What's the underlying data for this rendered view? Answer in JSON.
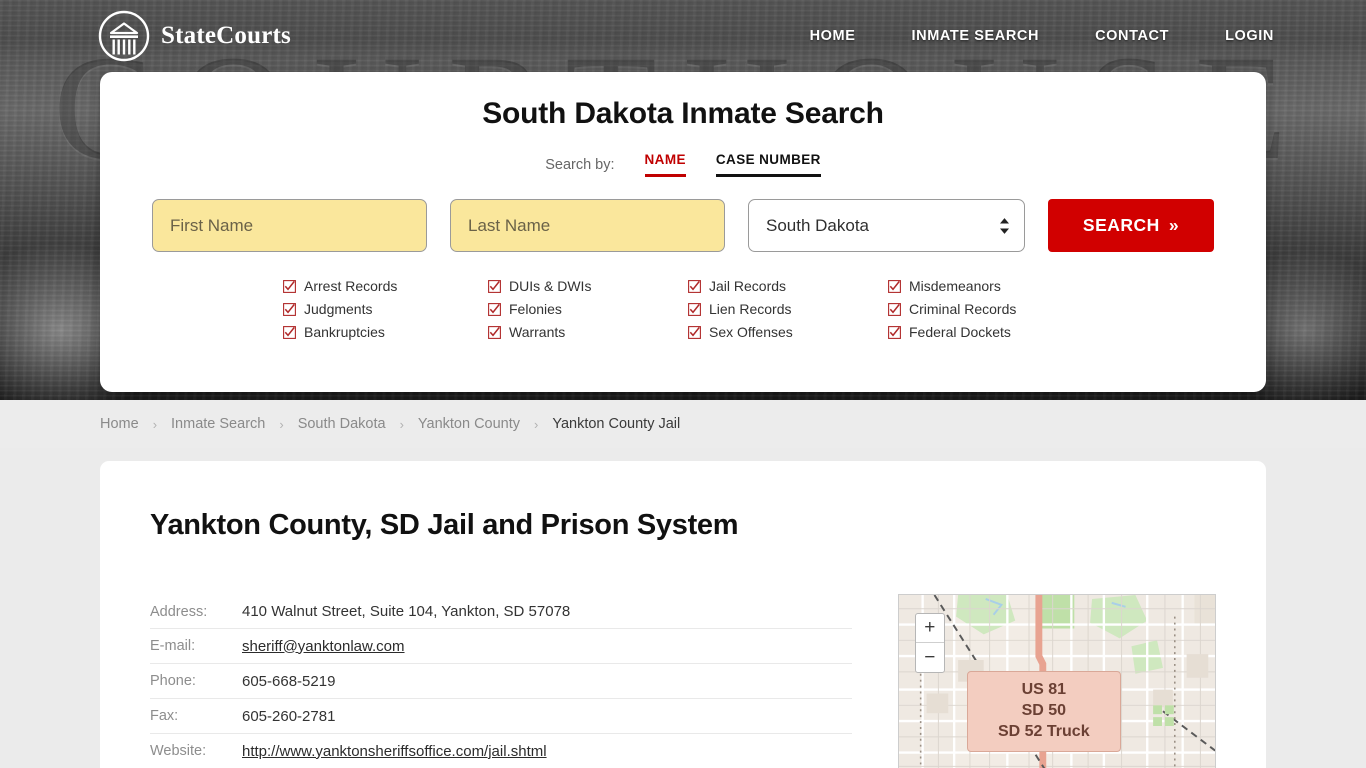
{
  "header": {
    "brand_name": "StateCourts",
    "logo_icon": "courthouse-circle-icon",
    "nav": [
      {
        "label": "HOME"
      },
      {
        "label": "INMATE SEARCH"
      },
      {
        "label": "CONTACT"
      },
      {
        "label": "LOGIN"
      }
    ],
    "background_ghost_text": "COURTHOUSE"
  },
  "search_card": {
    "title": "South Dakota Inmate Search",
    "search_by_label": "Search by:",
    "tabs": [
      {
        "label": "NAME",
        "active": true
      },
      {
        "label": "CASE NUMBER",
        "active": false
      }
    ],
    "first_name_placeholder": "First Name",
    "first_name_value": "",
    "last_name_placeholder": "Last Name",
    "last_name_value": "",
    "state_selected": "South Dakota",
    "search_button_label": "SEARCH",
    "search_button_chevron": "»",
    "checkbox_glyph": "☑",
    "accent_red": "#c00000",
    "button_red": "#d10000",
    "field_yellow": "#fae79c",
    "checks": [
      {
        "label": "Arrest Records",
        "checked": true
      },
      {
        "label": "DUIs & DWIs",
        "checked": true
      },
      {
        "label": "Jail Records",
        "checked": true
      },
      {
        "label": "Misdemeanors",
        "checked": true
      },
      {
        "label": "Judgments",
        "checked": true
      },
      {
        "label": "Felonies",
        "checked": true
      },
      {
        "label": "Lien Records",
        "checked": true
      },
      {
        "label": "Criminal Records",
        "checked": true
      },
      {
        "label": "Bankruptcies",
        "checked": true
      },
      {
        "label": "Warrants",
        "checked": true
      },
      {
        "label": "Sex Offenses",
        "checked": true
      },
      {
        "label": "Federal Dockets",
        "checked": true
      }
    ]
  },
  "breadcrumb": {
    "separator": "›",
    "items": [
      {
        "label": "Home",
        "current": false
      },
      {
        "label": "Inmate Search",
        "current": false
      },
      {
        "label": "South Dakota",
        "current": false
      },
      {
        "label": "Yankton County",
        "current": false
      },
      {
        "label": "Yankton County Jail",
        "current": true
      }
    ]
  },
  "main": {
    "page_title": "Yankton County, SD Jail and Prison System",
    "details": [
      {
        "label": "Address:",
        "value": "410 Walnut Street, Suite 104, Yankton, SD 57078",
        "is_link": false
      },
      {
        "label": "E-mail:",
        "value": "sheriff@yanktonlaw.com",
        "is_link": true
      },
      {
        "label": "Phone:",
        "value": "605-668-5219",
        "is_link": false
      },
      {
        "label": "Fax:",
        "value": "605-260-2781",
        "is_link": false
      },
      {
        "label": "Website:",
        "value": "http://www.yanktonsheriffsoffice.com/jail.shtml",
        "is_link": true
      }
    ],
    "map": {
      "zoom_in_label": "+",
      "zoom_out_label": "−",
      "highway_shield_lines": [
        "US 81",
        "SD 50",
        "SD 52 Truck"
      ],
      "shield_color": "#f3cdc0"
    }
  }
}
